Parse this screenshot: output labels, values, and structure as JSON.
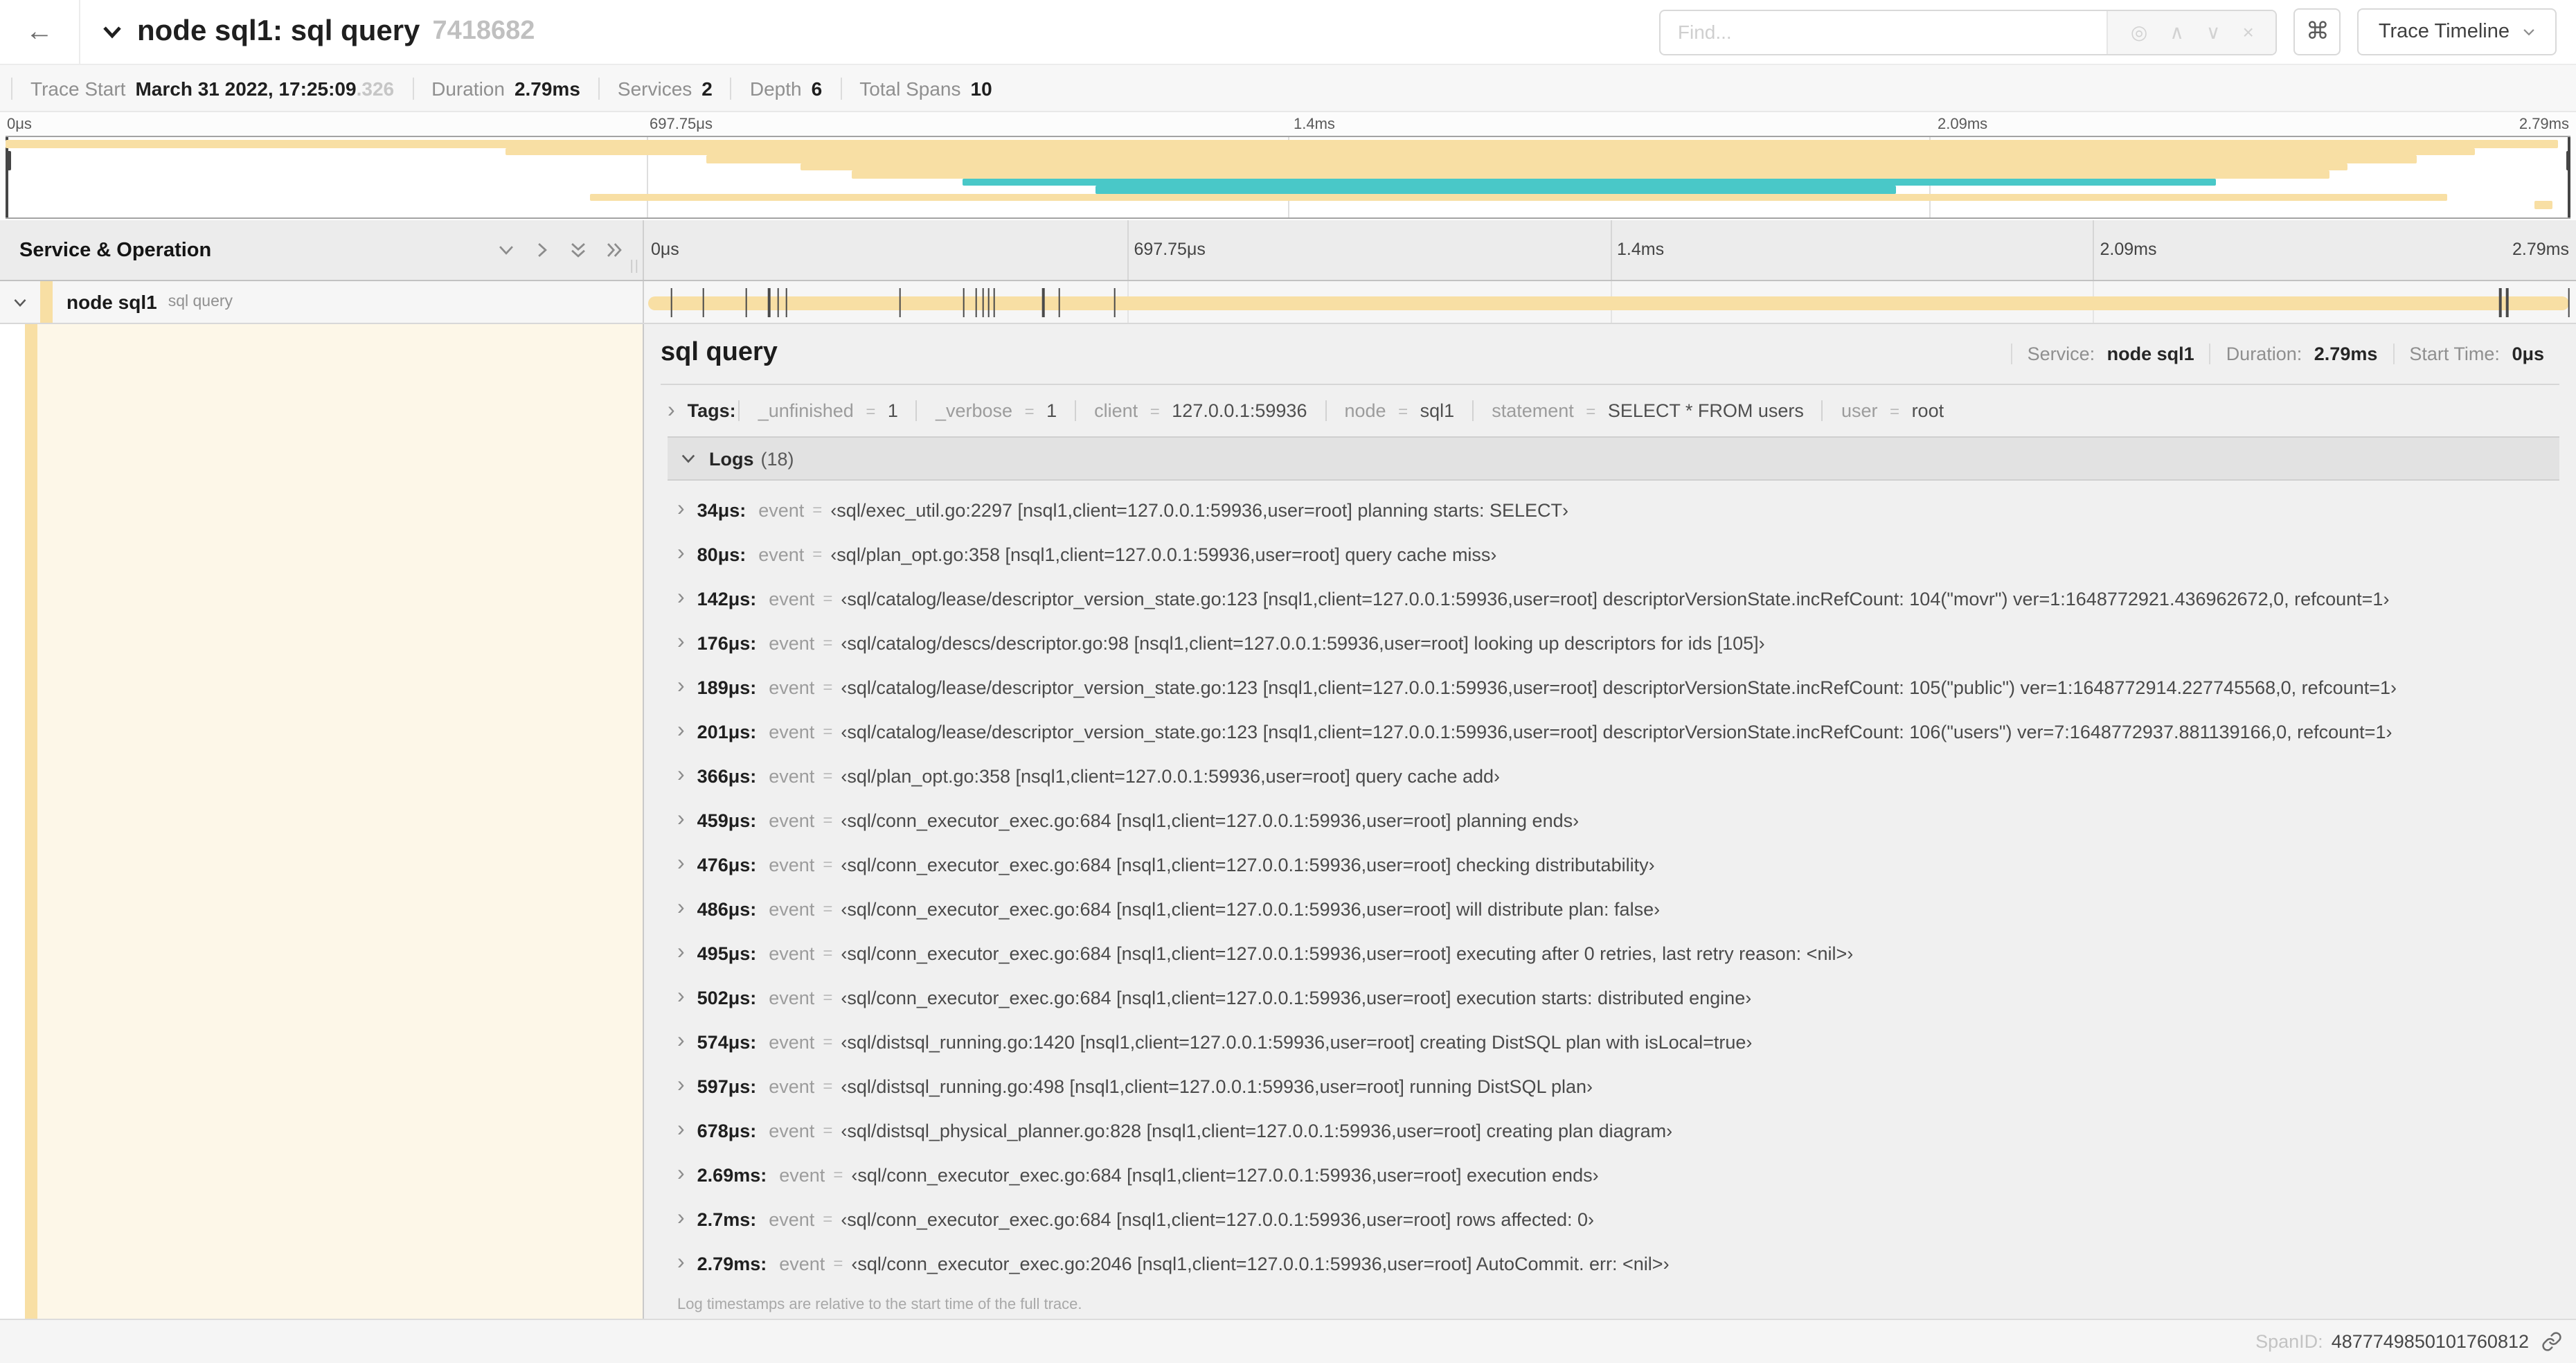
{
  "icons": {
    "back": "←",
    "locate": "◎",
    "up": "∧",
    "down": "∨",
    "close": "×",
    "shortcuts": "⌘",
    "chevron_right": "›",
    "drag": "||"
  },
  "header": {
    "title": "node sql1: sql query",
    "trace_id": "7418682",
    "find_placeholder": "Find...",
    "view_selector_label": "Trace Timeline"
  },
  "stats": [
    {
      "label": "Trace Start",
      "value": "March 31 2022, 17:25:09",
      "suffix": ".326"
    },
    {
      "label": "Duration",
      "value": "2.79ms"
    },
    {
      "label": "Services",
      "value": "2"
    },
    {
      "label": "Depth",
      "value": "6"
    },
    {
      "label": "Total Spans",
      "value": "10"
    }
  ],
  "minimap": {
    "labels": [
      "0μs",
      "697.75μs",
      "1.4ms",
      "2.09ms",
      "2.79ms"
    ],
    "spans": [
      {
        "row": 0,
        "start": 0,
        "end": 99.5,
        "color": "#f8dfa4"
      },
      {
        "row": 1,
        "start": 19.5,
        "end": 96.3,
        "color": "#f8dfa4"
      },
      {
        "row": 2,
        "start": 27.3,
        "end": 94.0,
        "color": "#f8dfa4"
      },
      {
        "row": 3,
        "start": 31.0,
        "end": 91.3,
        "color": "#f8dfa4"
      },
      {
        "row": 4,
        "start": 33.0,
        "end": 90.6,
        "color": "#f8dfa4"
      },
      {
        "row": 5,
        "start": 37.3,
        "end": 86.2,
        "color": "#49c8c8"
      },
      {
        "row": 6,
        "start": 42.5,
        "end": 73.7,
        "color": "#49c8c8"
      },
      {
        "row": 7,
        "start": 22.8,
        "end": 95.2,
        "color": "#f8dfa4"
      },
      {
        "row": 8,
        "start": 98.6,
        "end": 99.3,
        "color": "#f8dfa4"
      }
    ]
  },
  "timeline": {
    "left_header": "Service & Operation",
    "ruler_labels": [
      "0μs",
      "697.75μs",
      "1.4ms",
      "2.09ms",
      "2.79ms"
    ]
  },
  "span_row": {
    "service": "node sql1",
    "operation": "sql query",
    "bar_color": "#f8dfa4",
    "tint_color": "rgba(248,223,164,0.25)",
    "total_us": 2790,
    "tick_times_us": [
      34,
      80,
      142,
      176,
      189,
      201,
      366,
      459,
      476,
      486,
      495,
      502,
      574,
      597,
      678,
      2690,
      2700,
      2790
    ]
  },
  "detail": {
    "title": "sql query",
    "meta": [
      {
        "label": "Service:",
        "value": "node sql1"
      },
      {
        "label": "Duration:",
        "value": "2.79ms"
      },
      {
        "label": "Start Time:",
        "value": "0μs"
      }
    ],
    "tags": {
      "label": "Tags:",
      "eq": "=",
      "items": [
        {
          "key": "_unfinished",
          "value": "1"
        },
        {
          "key": "_verbose",
          "value": "1"
        },
        {
          "key": "client",
          "value": "127.0.0.1:59936"
        },
        {
          "key": "node",
          "value": "sql1"
        },
        {
          "key": "statement",
          "value": "SELECT * FROM users"
        },
        {
          "key": "user",
          "value": "root"
        }
      ]
    },
    "logs": {
      "label": "Logs",
      "count": "(18)",
      "eq": "=",
      "entries": [
        {
          "time": "34μs:",
          "key": "event",
          "text": "‹sql/exec_util.go:2297 [nsql1,client=127.0.0.1:59936,user=root] planning starts: SELECT›"
        },
        {
          "time": "80μs:",
          "key": "event",
          "text": "‹sql/plan_opt.go:358 [nsql1,client=127.0.0.1:59936,user=root] query cache miss›"
        },
        {
          "time": "142μs:",
          "key": "event",
          "text": "‹sql/catalog/lease/descriptor_version_state.go:123 [nsql1,client=127.0.0.1:59936,user=root] descriptorVersionState.incRefCount: 104(\"movr\") ver=1:1648772921.436962672,0, refcount=1›"
        },
        {
          "time": "176μs:",
          "key": "event",
          "text": "‹sql/catalog/descs/descriptor.go:98 [nsql1,client=127.0.0.1:59936,user=root] looking up descriptors for ids [105]›"
        },
        {
          "time": "189μs:",
          "key": "event",
          "text": "‹sql/catalog/lease/descriptor_version_state.go:123 [nsql1,client=127.0.0.1:59936,user=root] descriptorVersionState.incRefCount: 105(\"public\") ver=1:1648772914.227745568,0, refcount=1›"
        },
        {
          "time": "201μs:",
          "key": "event",
          "text": "‹sql/catalog/lease/descriptor_version_state.go:123 [nsql1,client=127.0.0.1:59936,user=root] descriptorVersionState.incRefCount: 106(\"users\") ver=7:1648772937.881139166,0, refcount=1›"
        },
        {
          "time": "366μs:",
          "key": "event",
          "text": "‹sql/plan_opt.go:358 [nsql1,client=127.0.0.1:59936,user=root] query cache add›"
        },
        {
          "time": "459μs:",
          "key": "event",
          "text": "‹sql/conn_executor_exec.go:684 [nsql1,client=127.0.0.1:59936,user=root] planning ends›"
        },
        {
          "time": "476μs:",
          "key": "event",
          "text": "‹sql/conn_executor_exec.go:684 [nsql1,client=127.0.0.1:59936,user=root] checking distributability›"
        },
        {
          "time": "486μs:",
          "key": "event",
          "text": "‹sql/conn_executor_exec.go:684 [nsql1,client=127.0.0.1:59936,user=root] will distribute plan: false›"
        },
        {
          "time": "495μs:",
          "key": "event",
          "text": "‹sql/conn_executor_exec.go:684 [nsql1,client=127.0.0.1:59936,user=root] executing after 0 retries, last retry reason: <nil>›"
        },
        {
          "time": "502μs:",
          "key": "event",
          "text": "‹sql/conn_executor_exec.go:684 [nsql1,client=127.0.0.1:59936,user=root] execution starts: distributed engine›"
        },
        {
          "time": "574μs:",
          "key": "event",
          "text": "‹sql/distsql_running.go:1420 [nsql1,client=127.0.0.1:59936,user=root] creating DistSQL plan with isLocal=true›"
        },
        {
          "time": "597μs:",
          "key": "event",
          "text": "‹sql/distsql_running.go:498 [nsql1,client=127.0.0.1:59936,user=root] running DistSQL plan›"
        },
        {
          "time": "678μs:",
          "key": "event",
          "text": "‹sql/distsql_physical_planner.go:828 [nsql1,client=127.0.0.1:59936,user=root] creating plan diagram›"
        },
        {
          "time": "2.69ms:",
          "key": "event",
          "text": "‹sql/conn_executor_exec.go:684 [nsql1,client=127.0.0.1:59936,user=root] execution ends›"
        },
        {
          "time": "2.7ms:",
          "key": "event",
          "text": "‹sql/conn_executor_exec.go:684 [nsql1,client=127.0.0.1:59936,user=root] rows affected: 0›"
        },
        {
          "time": "2.79ms:",
          "key": "event",
          "text": "‹sql/conn_executor_exec.go:2046 [nsql1,client=127.0.0.1:59936,user=root] AutoCommit. err: <nil>›"
        }
      ],
      "footnote": "Log timestamps are relative to the start time of the full trace."
    },
    "span_id_label": "SpanID:",
    "span_id": "4877749850101760812"
  }
}
